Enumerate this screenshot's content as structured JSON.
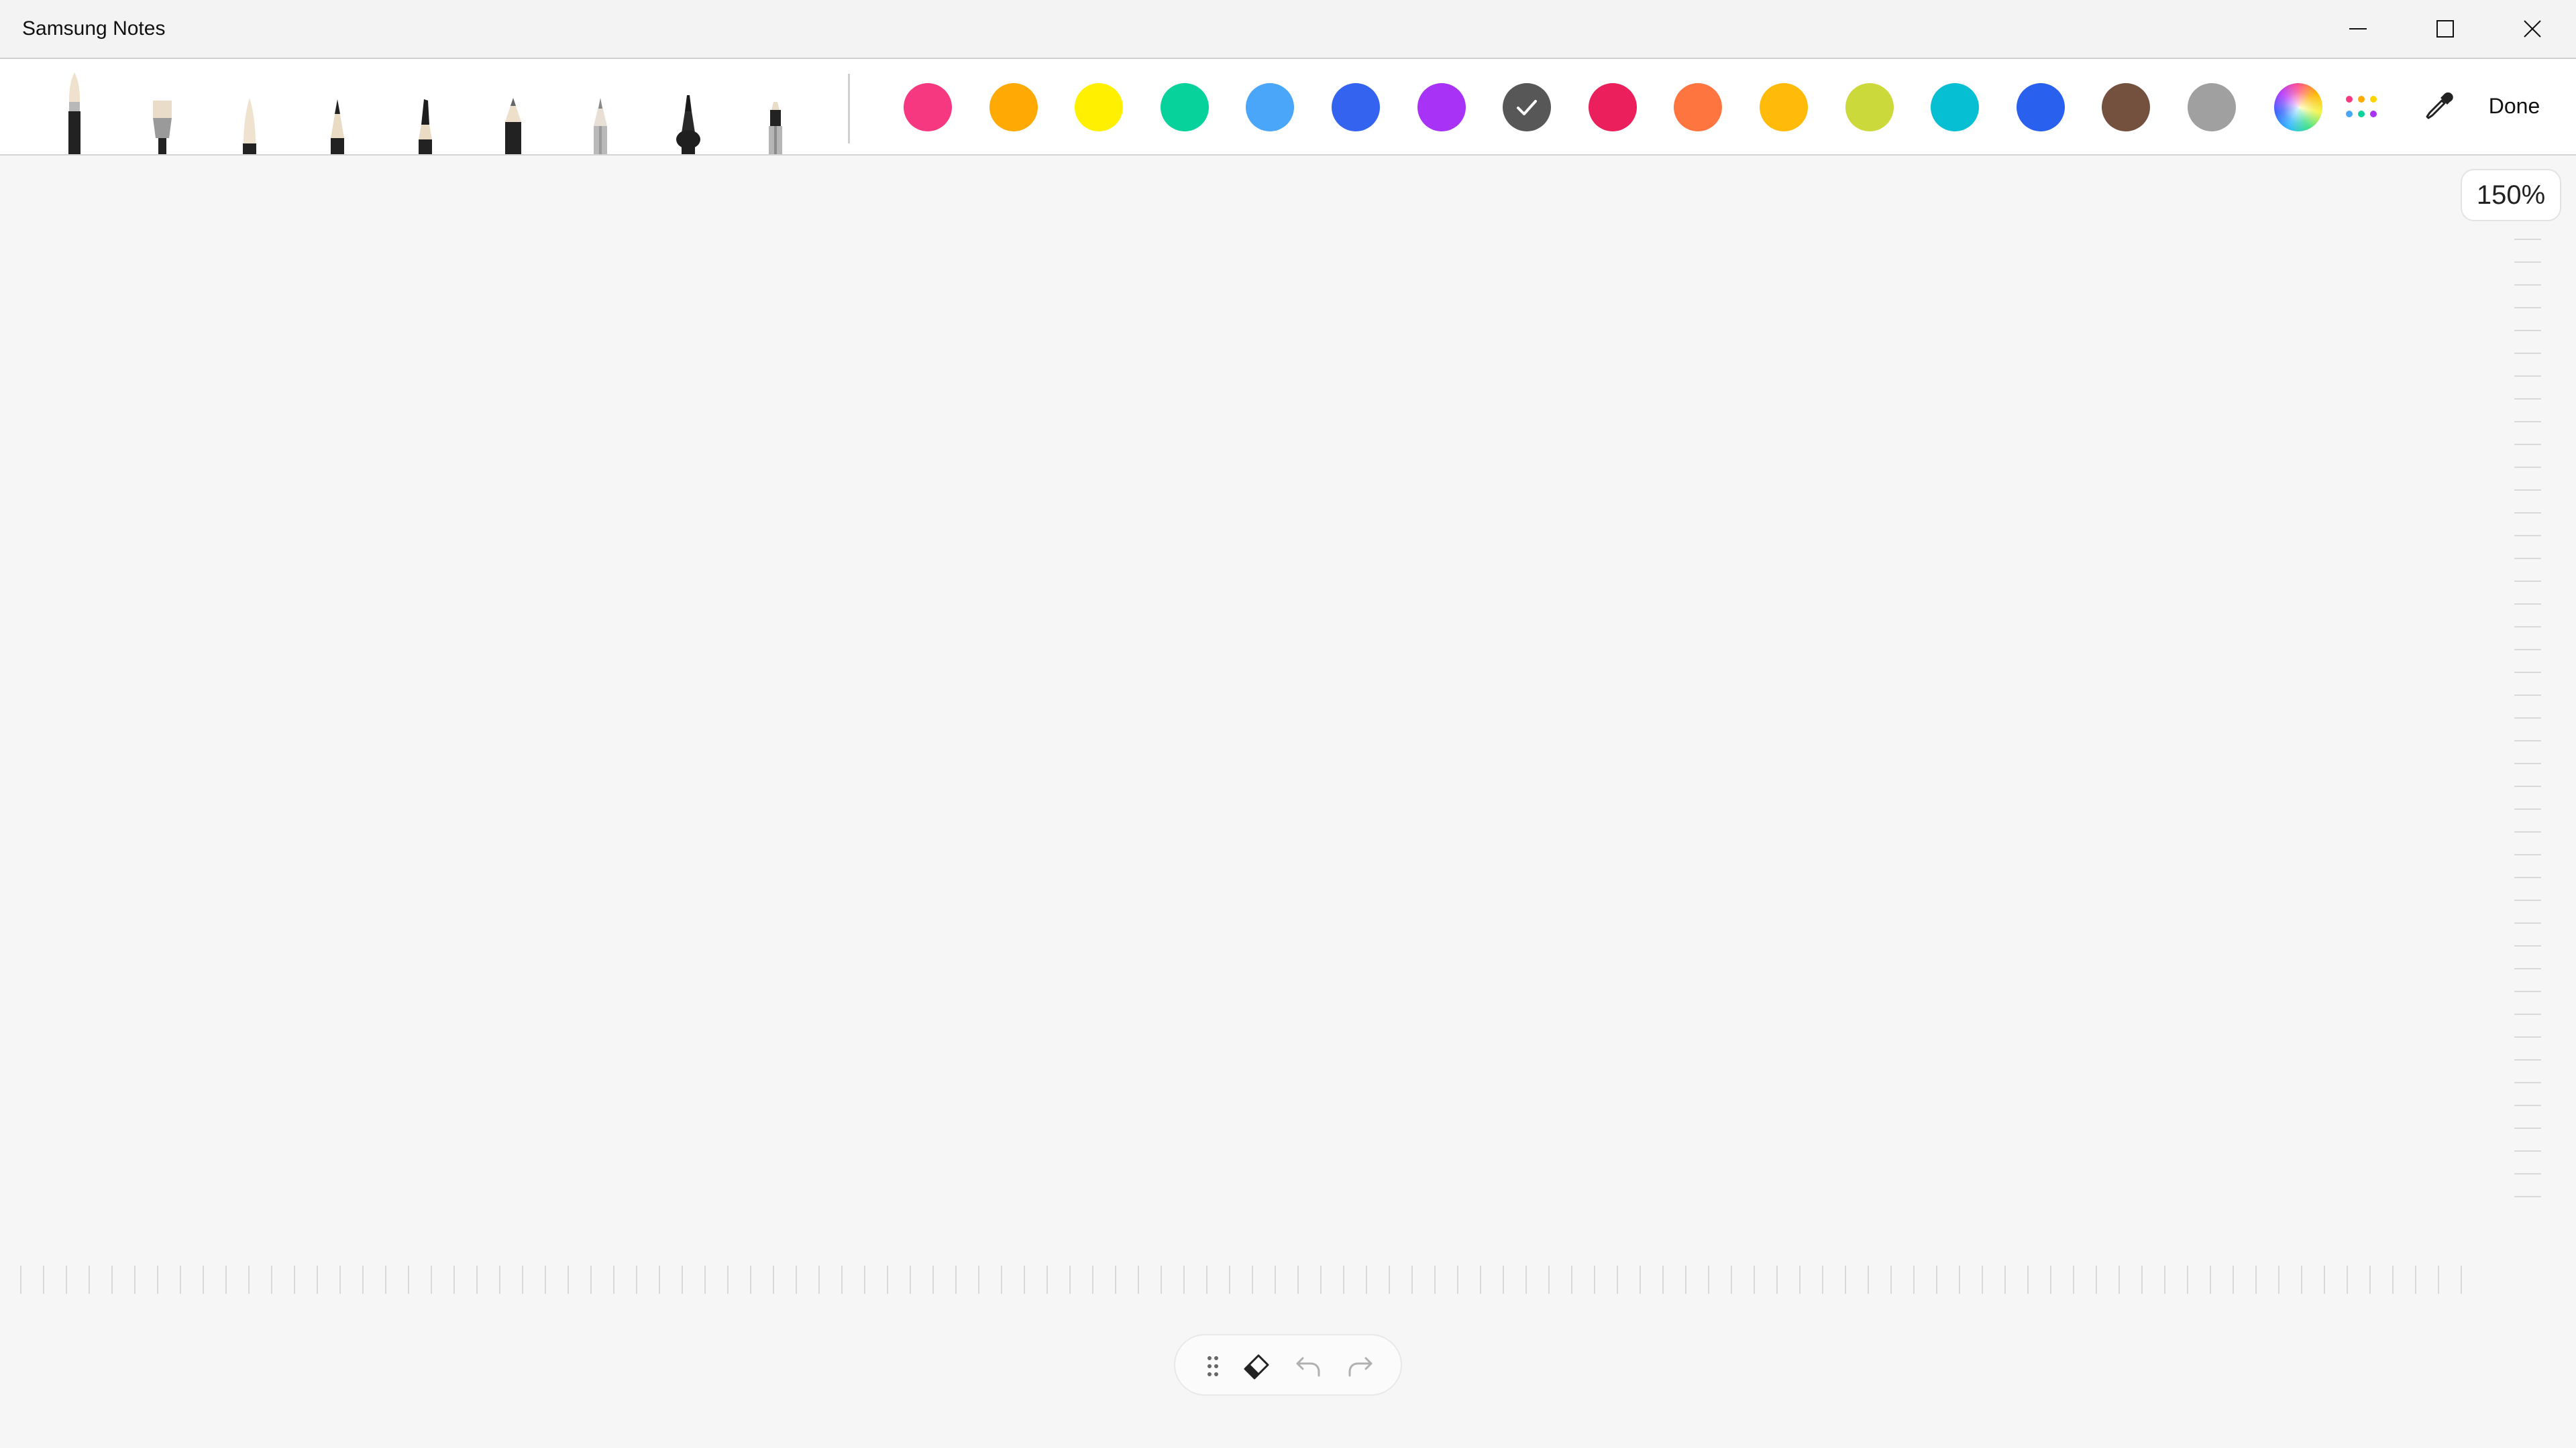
{
  "window": {
    "title": "Samsung Notes",
    "controls": [
      "minimize-icon",
      "maximize-icon",
      "close-icon"
    ]
  },
  "toolbar": {
    "pens": [
      "fountain-brush",
      "flat-brush",
      "soft-brush",
      "pencil",
      "calligraphy-pen",
      "marker-pen",
      "fine-pencil",
      "chisel-marker",
      "highlighter-pen"
    ],
    "colors": [
      {
        "name": "pink",
        "hex": "#F5387F"
      },
      {
        "name": "orange",
        "hex": "#FFA904"
      },
      {
        "name": "yellow",
        "hex": "#FFF000"
      },
      {
        "name": "green",
        "hex": "#08D29B"
      },
      {
        "name": "light-blue",
        "hex": "#4AA6F8"
      },
      {
        "name": "blue",
        "hex": "#3463F0"
      },
      {
        "name": "purple",
        "hex": "#A832F5"
      },
      {
        "name": "dark-gray",
        "hex": "#575757",
        "selected": true
      },
      {
        "name": "crimson",
        "hex": "#EA1F5C"
      },
      {
        "name": "coral",
        "hex": "#FF7540"
      },
      {
        "name": "amber",
        "hex": "#FFBA0A"
      },
      {
        "name": "lime",
        "hex": "#CBDA3A"
      },
      {
        "name": "cyan",
        "hex": "#06BFD3"
      },
      {
        "name": "royal-blue",
        "hex": "#2A60EE"
      },
      {
        "name": "brown",
        "hex": "#74503F"
      },
      {
        "name": "gray",
        "hex": "#A0A0A0"
      }
    ],
    "done_label": "Done"
  },
  "canvas": {
    "zoom_label": "150%"
  },
  "bottom_bar": {
    "items": [
      "drag-handle-icon",
      "eraser-icon",
      "undo-icon",
      "redo-icon"
    ]
  }
}
